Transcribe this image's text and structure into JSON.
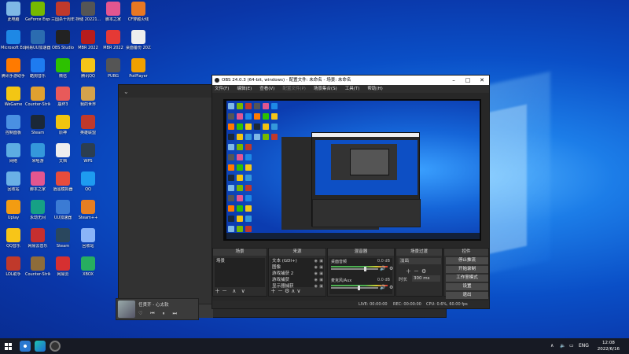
{
  "desktop": {
    "icons": [
      {
        "label": "此电脑",
        "color": "#7fb8e6"
      },
      {
        "label": "GeForce Experience",
        "color": "#76b900"
      },
      {
        "label": "三国杀十周年",
        "color": "#c0392b"
      },
      {
        "label": "存储 20221...",
        "color": "#555"
      },
      {
        "label": "脚本之家",
        "color": "#e3568f"
      },
      {
        "label": "CF穿越火线",
        "color": "#e87722"
      },
      {
        "label": "Microsoft Edge",
        "color": "#1e88e5"
      },
      {
        "label": "网易UU加速器",
        "color": "#2b6cb0"
      },
      {
        "label": "OBS Studio",
        "color": "#222"
      },
      {
        "label": "MBR 2022",
        "color": "#b71c1c"
      },
      {
        "label": "MBR 2022",
        "color": "#e53935"
      },
      {
        "label": "桌面备份 2022.06...",
        "color": "#eee"
      },
      {
        "label": "腾讯手游助手",
        "color": "#ff7a00"
      },
      {
        "label": "酷狗音乐",
        "color": "#1e7bf0"
      },
      {
        "label": "微信",
        "color": "#2dc100"
      },
      {
        "label": "腾讯QQ",
        "color": "#f5c518"
      },
      {
        "label": "PUBG",
        "color": "#555"
      },
      {
        "label": "PotPlayer",
        "color": "#f0a000"
      },
      {
        "label": "WeGame",
        "color": "#f3c614"
      },
      {
        "label": "Counter-Strike",
        "color": "#e0a030"
      },
      {
        "label": "崩坏3",
        "color": "#e85a5a"
      },
      {
        "label": "我的世界",
        "color": "#d4a24c"
      },
      {
        "label": "控制面板",
        "color": "#4a90e2"
      },
      {
        "label": "Steam",
        "color": "#1b2838"
      },
      {
        "label": "原神",
        "color": "#f1c40f"
      },
      {
        "label": "英雄联盟",
        "color": "#c0392b"
      },
      {
        "label": "网络",
        "color": "#5dade2"
      },
      {
        "label": "米哈游",
        "color": "#3498db"
      },
      {
        "label": "文档",
        "color": "#eee"
      },
      {
        "label": "WPS",
        "color": "#2c3e50"
      },
      {
        "label": "回收站",
        "color": "#6ab0e6"
      },
      {
        "label": "脚本之家",
        "color": "#e3568f"
      },
      {
        "label": "逍遥模拟器",
        "color": "#e74c3c"
      },
      {
        "label": "QQ",
        "color": "#1e9bf0"
      },
      {
        "label": "Uplay",
        "color": "#f39c12"
      },
      {
        "label": "永劫无间",
        "color": "#16a085"
      },
      {
        "label": "UU加速器",
        "color": "#3b7bd4"
      },
      {
        "label": "Steam++",
        "color": "#e67e22"
      },
      {
        "label": "QQ音乐",
        "color": "#f7c518"
      },
      {
        "label": "网易云音乐",
        "color": "#c62f2f"
      },
      {
        "label": "Steam",
        "color": "#2a475e"
      },
      {
        "label": "回收站",
        "color": "#8ab4f8"
      },
      {
        "label": "LOL助手",
        "color": "#c0392b"
      },
      {
        "label": "Counter-Strike",
        "color": "#8e6c3a"
      },
      {
        "label": "网易云",
        "color": "#d63031"
      },
      {
        "label": "XBOX",
        "color": "#27ae60"
      }
    ]
  },
  "side_window": {
    "music": {
      "title": "任贤齐 - 心太软",
      "controls": "♡ ⏮ ⏸ ⏭"
    }
  },
  "obs": {
    "title": "OBS 24.0.3 (64-bit, windows) - 配置文件: 未命名 - 场景: 未命名",
    "menu": [
      {
        "label": "文件(F)",
        "dim": false
      },
      {
        "label": "编辑(E)",
        "dim": false
      },
      {
        "label": "查看(V)",
        "dim": false
      },
      {
        "label": "配置文件(P)",
        "dim": true
      },
      {
        "label": "场景集合(S)",
        "dim": false
      },
      {
        "label": "工具(T)",
        "dim": false
      },
      {
        "label": "帮助(H)",
        "dim": false
      }
    ],
    "docks": {
      "scenes": {
        "title": "场景",
        "items": [
          "场景"
        ]
      },
      "sources": {
        "title": "来源",
        "items": [
          "文本 (GDI+)",
          "图像",
          "游戏捕获 2",
          "游戏捕获",
          "显示器捕获"
        ]
      },
      "mixer": {
        "title": "混音器",
        "channels": [
          {
            "name": "桌面音频",
            "db": "0.0 dB",
            "level": 0.72
          },
          {
            "name": "麦克风/Aux",
            "db": "0.0 dB",
            "level": 0.58
          }
        ]
      },
      "transitions": {
        "title": "场景过渡",
        "type": "淡出",
        "duration_label": "时长",
        "duration_value": "300 ms"
      },
      "controls": {
        "title": "控件",
        "buttons": [
          "停止推流",
          "开始录制",
          "工作室模式",
          "设置",
          "退出"
        ]
      }
    },
    "status": {
      "live": "LIVE: 00:00:00",
      "rec": "REC: 00:00:00",
      "cpu": "CPU: 0.6%, 60.00 fps"
    }
  },
  "taskbar": {
    "lang": "ENG",
    "time": "12:08",
    "date": "2022/6/16"
  }
}
